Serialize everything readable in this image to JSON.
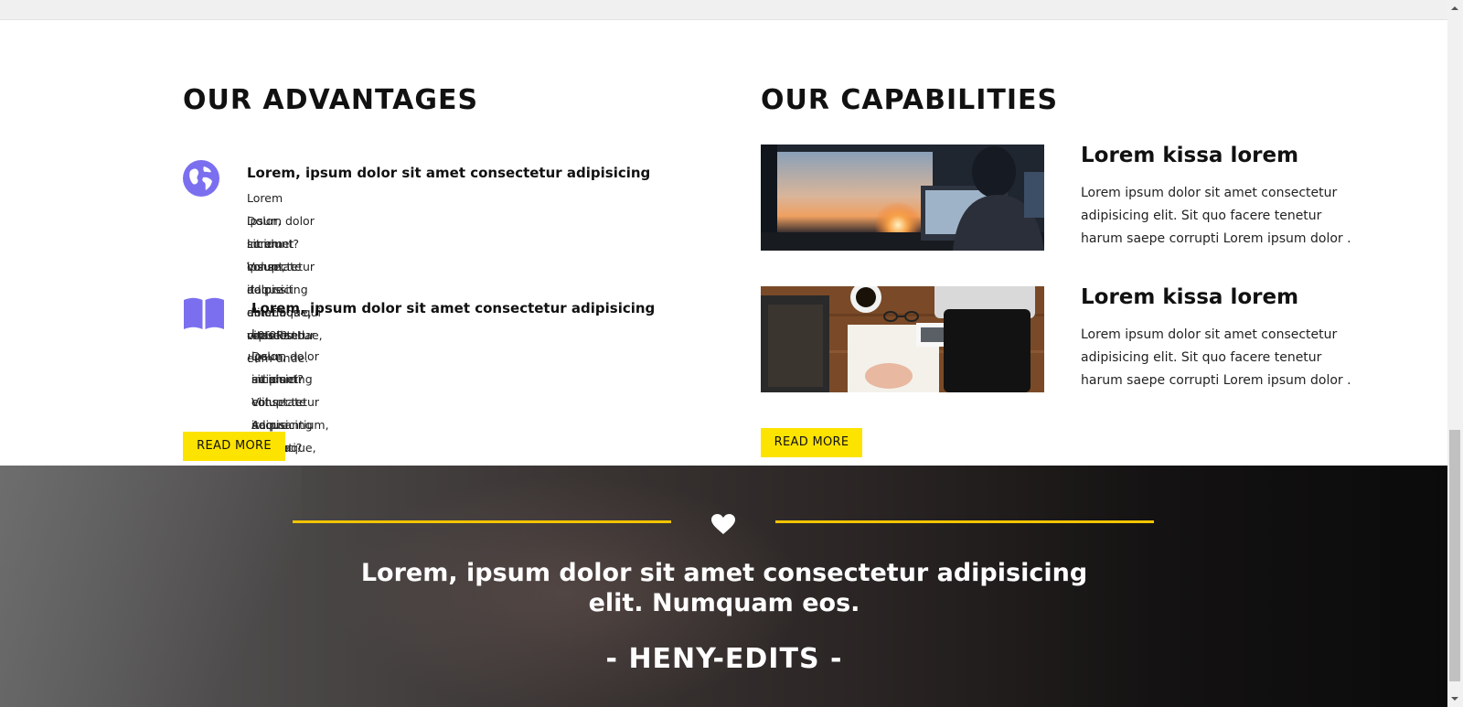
{
  "advantages": {
    "title": "OUR ADVANTAGES",
    "items": [
      {
        "icon": "globe-icon",
        "heading": "Lorem, ipsum dolor sit amet consectetur adipisicing",
        "lines": [
          "Lorem ipsum dolor sit amet consectetur adipisicing elit. Eaque, vitae est!",
          "Dolor, incidunt? Voluptate itaque doloribus qui repudiandae, eum unde.",
          "Lorem ipsum, dolor sit amet consectetur !"
        ]
      },
      {
        "icon": "book-icon",
        "heading": "Lorem, ipsum dolor sit amet consectetur adipisicing",
        "lines": [
          "Lorem ipsum dolor sit amet consectetur adipisicing elit. Eaque, vitae est!",
          "Dolor, incidunt? Voluptate itaque Lorem ipsum dolor sit amet consectetur",
          "adipisicing elit. Accusantium, corrupti?"
        ]
      }
    ],
    "button_label": "READ MORE"
  },
  "capabilities": {
    "title": "OUR CAPABILITIES",
    "items": [
      {
        "image": "person-at-laptop-sunset-photo",
        "title": "Lorem kissa lorem",
        "lines": [
          "Lorem ipsum dolor sit amet consectetur",
          "adipisicing elit. Sit quo facere tenetur",
          "harum saepe corrupti Lorem ipsum dolor ."
        ]
      },
      {
        "image": "desk-with-coffee-and-notebook-photo",
        "title": "Lorem kissa lorem",
        "lines": [
          "Lorem ipsum dolor sit amet consectetur",
          "adipisicing elit. Sit quo facere tenetur",
          "harum saepe corrupti Lorem ipsum dolor ."
        ]
      }
    ],
    "button_label": "READ MORE"
  },
  "testimonial": {
    "icon": "heart-icon",
    "quote_line1": "Lorem, ipsum dolor sit amet consectetur adipisicing",
    "quote_line2": "elit. Numquam eos.",
    "author": "- HENY-EDITS -"
  },
  "colors": {
    "accent_yellow": "#fde300",
    "icon_purple": "#7b6ff0",
    "divider_gold": "#f2c400"
  }
}
